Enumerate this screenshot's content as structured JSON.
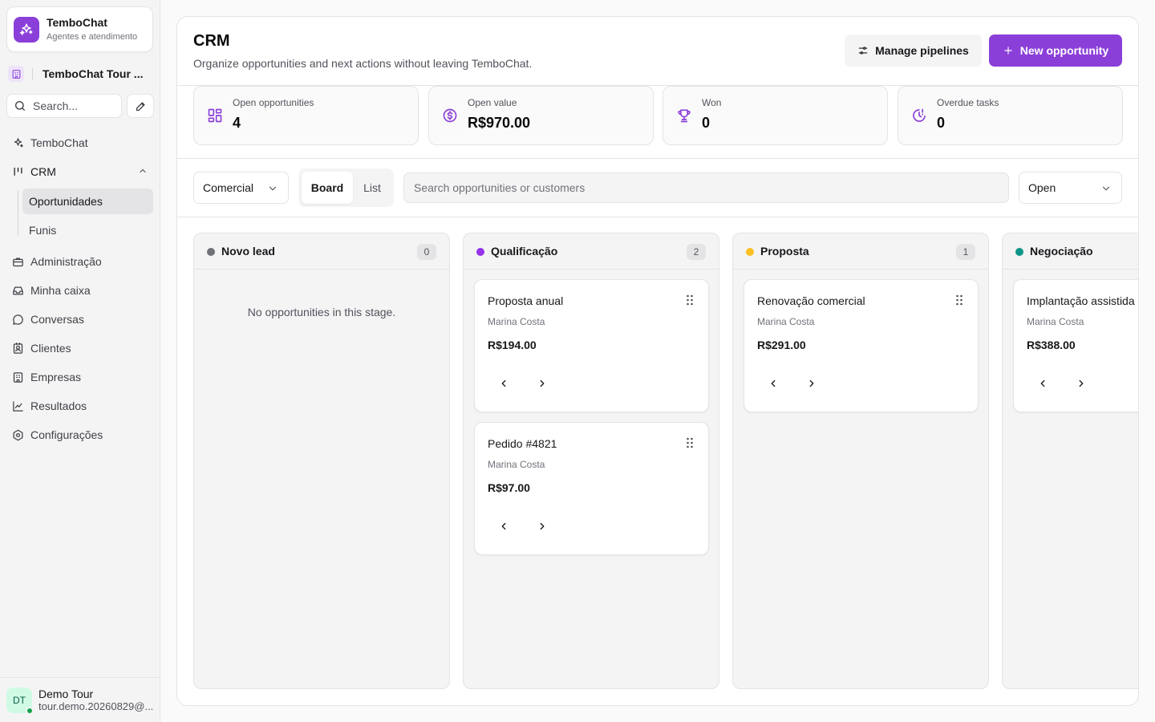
{
  "sidebar": {
    "brand": {
      "name": "TemboChat",
      "subtitle": "Agentes e atendimento"
    },
    "workspace": {
      "name": "TemboChat Tour ..."
    },
    "search_placeholder": "Search...",
    "nav": [
      {
        "label": "TemboChat",
        "icon": "sparkles-icon"
      },
      {
        "label": "CRM",
        "icon": "kanban-icon"
      },
      {
        "label": "Administração",
        "icon": "briefcase-icon"
      },
      {
        "label": "Minha caixa",
        "icon": "inbox-icon"
      },
      {
        "label": "Conversas",
        "icon": "chat-bubble-icon"
      },
      {
        "label": "Clientes",
        "icon": "contact-icon"
      },
      {
        "label": "Empresas",
        "icon": "building-icon"
      },
      {
        "label": "Resultados",
        "icon": "line-chart-icon"
      },
      {
        "label": "Configurações",
        "icon": "settings-icon"
      }
    ],
    "crm_sub": [
      {
        "label": "Oportunidades",
        "active": true
      },
      {
        "label": "Funis",
        "active": false
      }
    ],
    "user": {
      "initials": "DT",
      "name": "Demo Tour",
      "email": "tour.demo.20260829@..."
    }
  },
  "header": {
    "title": "CRM",
    "subtitle": "Organize opportunities and next actions without leaving TemboChat.",
    "manage_label": "Manage pipelines",
    "new_label": "New opportunity"
  },
  "stats": [
    {
      "label": "Open opportunities",
      "value": "4",
      "icon": "layout-grid-icon"
    },
    {
      "label": "Open value",
      "value": "R$970.00",
      "icon": "dollar-circle-icon"
    },
    {
      "label": "Won",
      "value": "0",
      "icon": "trophy-icon"
    },
    {
      "label": "Overdue tasks",
      "value": "0",
      "icon": "clock-alert-icon"
    }
  ],
  "toolbar": {
    "pipeline": "Comercial",
    "view_board": "Board",
    "view_list": "List",
    "search_placeholder": "Search opportunities or customers",
    "status": "Open"
  },
  "board": {
    "empty_text": "No opportunities in this stage.",
    "columns": [
      {
        "title": "Novo lead",
        "count": "0",
        "color": "#71717a",
        "cards": []
      },
      {
        "title": "Qualificação",
        "count": "2",
        "color": "#9333ea",
        "cards": [
          {
            "title": "Proposta anual",
            "customer": "Marina Costa",
            "value": "R$194.00"
          },
          {
            "title": "Pedido #4821",
            "customer": "Marina Costa",
            "value": "R$97.00"
          }
        ]
      },
      {
        "title": "Proposta",
        "count": "1",
        "color": "#fbbf24",
        "cards": [
          {
            "title": "Renovação comercial",
            "customer": "Marina Costa",
            "value": "R$291.00"
          }
        ]
      },
      {
        "title": "Negociação",
        "count": "",
        "color": "#0d9488",
        "cards": [
          {
            "title": "Implantação assistida",
            "customer": "Marina Costa",
            "value": "R$388.00"
          }
        ]
      }
    ]
  },
  "colors": {
    "accent": "#8b3fd9",
    "border": "#e4e4e7",
    "muted_bg": "#f4f4f5"
  }
}
